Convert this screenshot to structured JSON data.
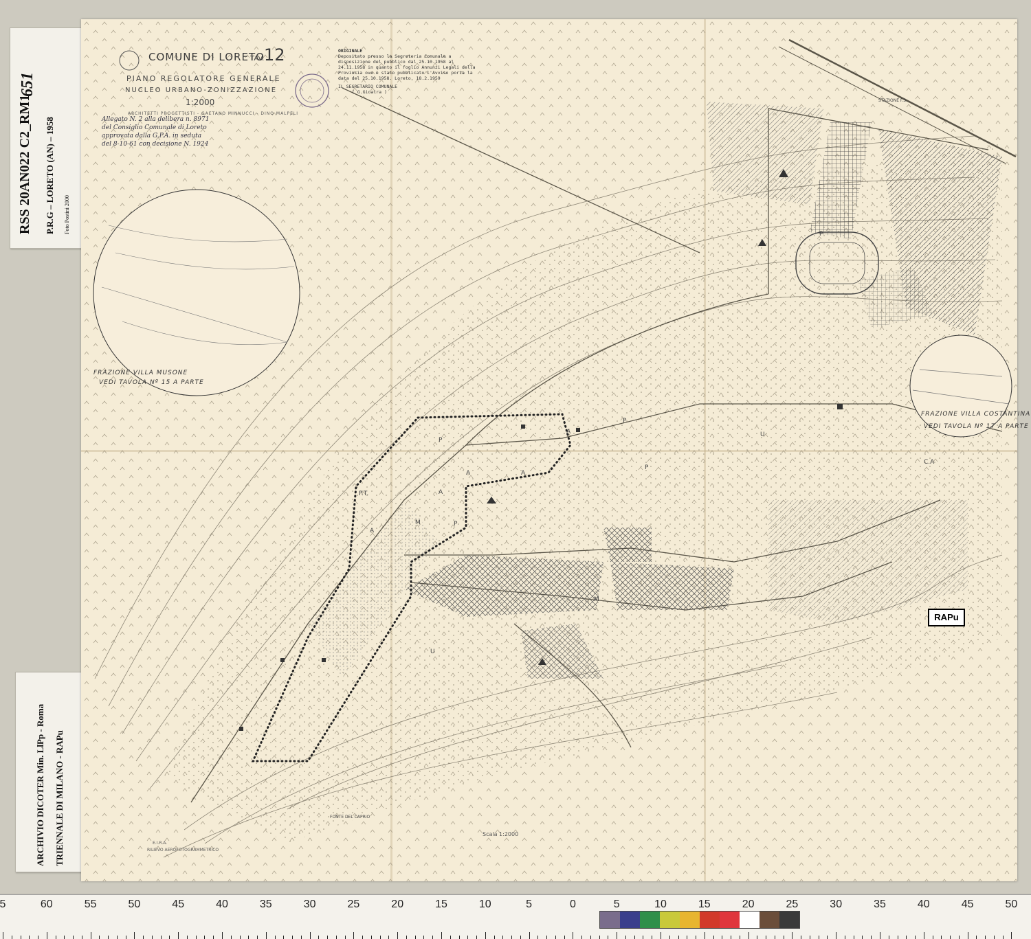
{
  "archive_label_top": {
    "code": "RSS 20AN022 C2_RM1",
    "number": "651",
    "subtitle": "P.R.G – LORETO (AN) – 1958",
    "photo_credit": "Foto Postini 2000"
  },
  "archive_label_bottom": {
    "line1": "ARCHIVIO DICOTER Min. LlPp - Roma",
    "line2": "TRIENNALE DI MILANO - RAPu"
  },
  "map": {
    "title": "COMUNE DI LORETO",
    "tav_label": "TAV.",
    "tav_number": "12",
    "subtitle": "PIANO REGOLATORE GENERALE",
    "subtitle2": "NUCLEO URBANO-ZONIZZAZIONE",
    "scale": "1:2000",
    "architects": "ARCHITETTI PROGETTISTI - GAETANO MINNUCCI - DINO MALPELI",
    "original_block": {
      "heading": "ORIGINALE",
      "text": "Depositato presso la Segreteria Comunale a disposizione del pubblico dal 25.10.1958 al 24.11.1958 in quanto il foglio Annunzi Legali della Provincia ove è stato pubblicato l'Avviso porta la data del 25.10.1958. Loreto, 18.2.1959",
      "signature_title": "IL SEGRETARIO COMUNALE",
      "signature_name": "( G.Gioatra )"
    },
    "handwritten_note": "Allegato N. 2 alla delibera n. 8971 del Consiglio Comunale di Loreto approvata dalla G.P.A. in seduta del 8-10-61 con decisione N. 1924",
    "circle_left_caption1": "FRAZIONE VILLA MUSONE",
    "circle_left_caption2": "VEDI TAVOLA Nº 15 A PARTE",
    "circle_right_caption1": "FRAZIONE VILLA COSTANTINA",
    "circle_right_caption2": "VEDI TAVOLA Nº 17 A PARTE",
    "station_label": "STAZIONE F.S.",
    "fonte_label": "FONTE DEL CAPRIO",
    "footer_scale": "Scala 1:2000",
    "footer_credit": "RILIEVO AEROFOTOGRAMMETRICO",
    "footer_eira": "E.I.R.A.",
    "rapu_tag": "RAPu",
    "zone_letters": [
      "A",
      "A",
      "A",
      "A",
      "A",
      "P",
      "P",
      "P",
      "P",
      "P",
      "M",
      "M",
      "U",
      "U",
      "C.A",
      "P.T."
    ]
  },
  "ruler": {
    "numbers": [
      "5",
      "60",
      "55",
      "50",
      "45",
      "40",
      "35",
      "30",
      "25",
      "20",
      "15",
      "10",
      "5",
      "0",
      "5",
      "10",
      "15",
      "20",
      "25",
      "30",
      "35",
      "40",
      "45",
      "50"
    ],
    "swatch_colors": [
      "#7a6d8c",
      "#3a3f8c",
      "#2f8f4a",
      "#c9c93a",
      "#e8b530",
      "#d23a2a",
      "#e0363d",
      "#ffffff",
      "#6b4e3a",
      "#3a3a3a"
    ]
  }
}
